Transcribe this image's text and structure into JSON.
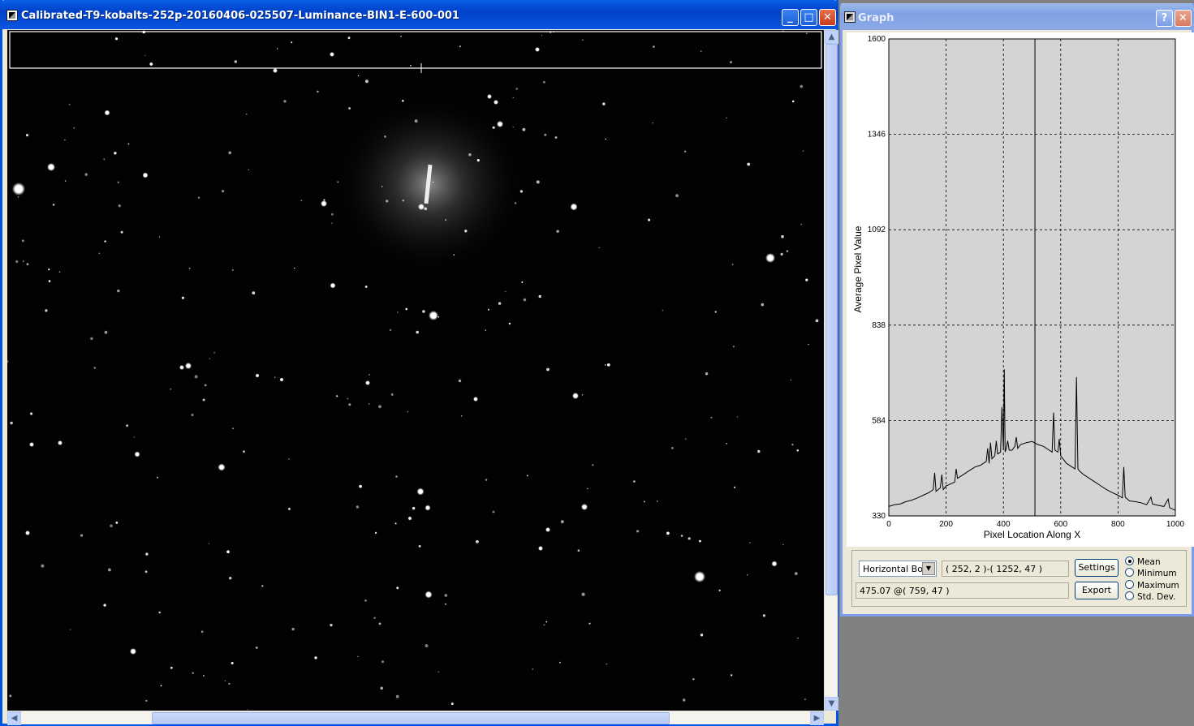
{
  "image_window": {
    "title": "Calibrated-T9-kobalts-252p-20160406-025507-Luminance-BIN1-E-600-001",
    "buttons": {
      "minimize": "_",
      "maximize": "□",
      "close": "✕"
    }
  },
  "graph_window": {
    "title": "Graph",
    "buttons": {
      "help": "?",
      "close": "✕"
    }
  },
  "chart_data": {
    "type": "line",
    "xlabel": "Pixel Location Along X",
    "ylabel": "Average Pixel Value",
    "xlim": [
      0,
      1000
    ],
    "ylim": [
      330,
      1600
    ],
    "xticks": [
      0,
      200,
      400,
      600,
      800,
      1000
    ],
    "yticks": [
      330,
      584,
      838,
      1092,
      1346,
      1600
    ],
    "grid": true,
    "cursor_x": 510,
    "series": [
      {
        "x": [
          0,
          20,
          40,
          60,
          80,
          100,
          120,
          140,
          155,
          160,
          165,
          180,
          185,
          190,
          200,
          230,
          235,
          240,
          260,
          280,
          300,
          320,
          340,
          345,
          350,
          355,
          360,
          370,
          375,
          380,
          390,
          395,
          400,
          403,
          406,
          410,
          415,
          420,
          430,
          440,
          445,
          450,
          460,
          480,
          500,
          520,
          540,
          560,
          570,
          575,
          580,
          590,
          595,
          600,
          610,
          620,
          640,
          650,
          655,
          660,
          665,
          680,
          700,
          720,
          740,
          760,
          780,
          800,
          815,
          820,
          825,
          840,
          860,
          880,
          900,
          915,
          920,
          940,
          960,
          975,
          980,
          1000
        ],
        "y": [
          355,
          360,
          362,
          368,
          372,
          378,
          385,
          392,
          400,
          445,
          395,
          405,
          440,
          400,
          410,
          420,
          455,
          430,
          440,
          450,
          460,
          465,
          475,
          510,
          470,
          525,
          482,
          490,
          530,
          495,
          500,
          620,
          505,
          720,
          500,
          510,
          530,
          505,
          505,
          515,
          540,
          510,
          520,
          525,
          528,
          520,
          515,
          505,
          500,
          605,
          505,
          500,
          535,
          490,
          480,
          470,
          460,
          455,
          700,
          455,
          450,
          440,
          430,
          420,
          410,
          400,
          392,
          385,
          378,
          460,
          380,
          370,
          368,
          365,
          360,
          380,
          362,
          358,
          355,
          375,
          352,
          345
        ]
      }
    ]
  },
  "controls": {
    "profile_type": "Horizontal Box",
    "box_coords": "( 252, 2 )-( 1252, 47 )",
    "readout": "475.07 @( 759, 47 )",
    "settings_label": "Settings",
    "export_label": "Export",
    "radio": [
      {
        "label": "Mean",
        "selected": true
      },
      {
        "label": "Minimum",
        "selected": false
      },
      {
        "label": "Maximum",
        "selected": false
      },
      {
        "label": "Std. Dev.",
        "selected": false
      }
    ]
  }
}
